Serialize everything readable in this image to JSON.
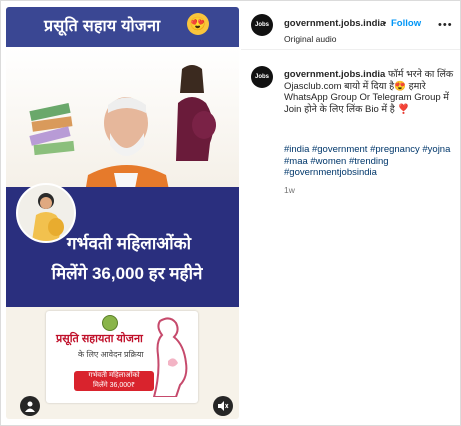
{
  "media": {
    "banner_title": "प्रसूति सहाय योजना",
    "banner_emoji": "😍",
    "headline_line1": "गर्भवती महिलाओंको",
    "headline_line2": "मिलेंगे 36,000 हर महीने",
    "card_title": "प्रसूति सहायता योजना",
    "card_subtitle": "के लिए आवेदन प्रक्रिया",
    "card_pill_line1": "गर्भवती महिलाओंको",
    "card_pill_line2": "मिलेंगे 36,000₹"
  },
  "post": {
    "username": "government.jobs.india",
    "separator": "•",
    "follow_label": "Follow",
    "audio_label": "Original audio",
    "more_label": "•••",
    "avatar_text": "Jobs India",
    "caption_user": "government.jobs.india",
    "caption_text": "फॉर्म भरने का लिंक Ojasclub.com बायो में दिया है😍 हमारे WhatsApp Group Or Telegram Group में Join होने के लिए लिंक Bio में है",
    "caption_heart": "❣️",
    "hashtags": "#india #government #pregnancy #yojna #maa #women #trending #governmentjobsindia",
    "time": "1w"
  },
  "colors": {
    "banner": "#3a4793",
    "navy": "#2a2f7e",
    "follow": "#0095f6",
    "hashtag": "#00376b"
  }
}
